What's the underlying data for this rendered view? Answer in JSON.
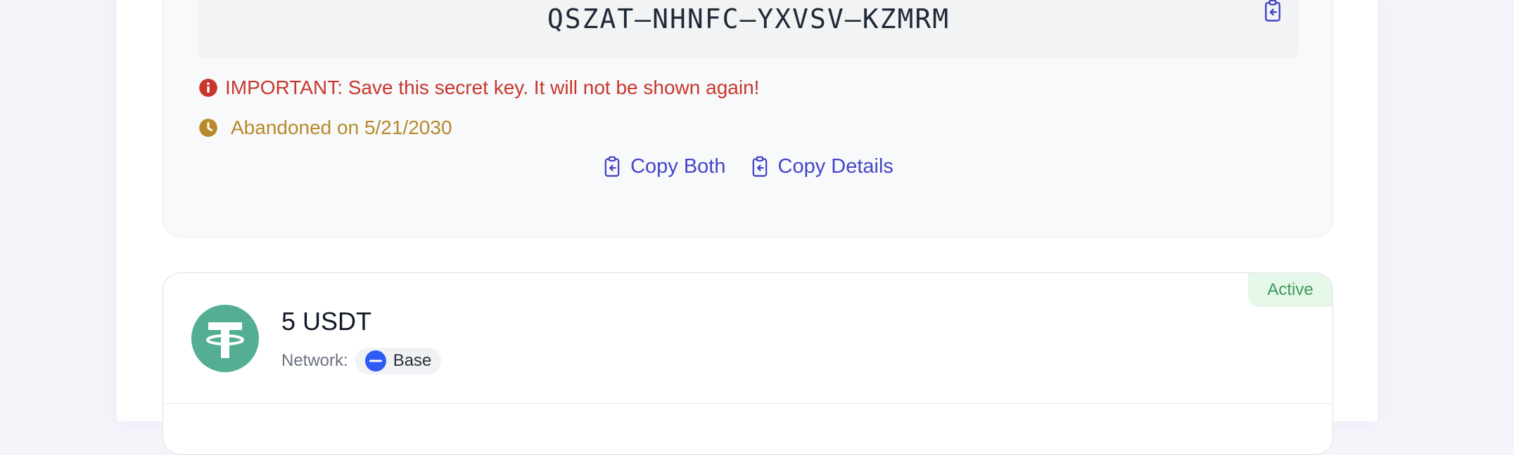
{
  "secret": {
    "key": "QSZAT–NHNFC–YXVSV–KZMRM",
    "warning": "IMPORTANT: Save this secret key. It will not be shown again!",
    "status_line": "Abandoned on 5/21/2030",
    "actions": {
      "copy_both": "Copy Both",
      "copy_details": "Copy Details"
    }
  },
  "payment": {
    "status": "Active",
    "amount": "5 USDT",
    "network_label": "Network:",
    "network": "Base",
    "token_icon": "tether-icon",
    "network_icon": "base-network-icon"
  },
  "colors": {
    "accent": "#4545c8",
    "warning": "#c8372d",
    "abandoned": "#b8892a",
    "active_bg": "#e4f7e8",
    "active_text": "#3f9a5a",
    "tether_green": "#53ae94",
    "base_blue": "#2f5bf5"
  }
}
